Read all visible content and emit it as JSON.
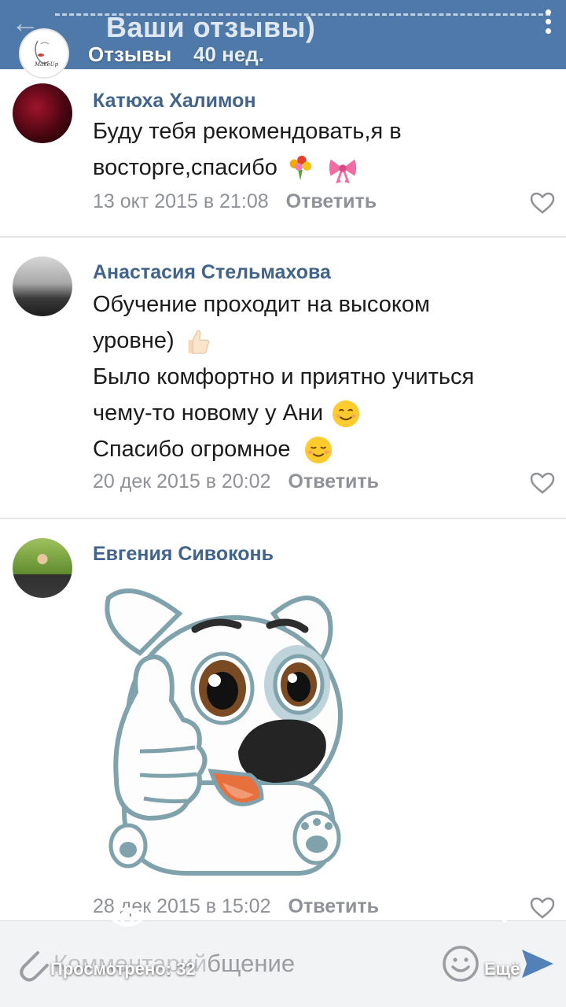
{
  "header": {
    "topic": "Ваши отзывы)",
    "story_author": "Отзывы",
    "story_time": "40 нед."
  },
  "comments": [
    {
      "name": "Катюха Халимон",
      "lines": [
        "Буду тебя рекомендовать,я в",
        "восторге,спасибо"
      ],
      "date": "13 окт 2015 в 21:08",
      "reply": "Ответить"
    },
    {
      "name": "Анастасия Стельмахова",
      "lines": [
        "Обучение проходит на высоком",
        "уровне)",
        "Было комфортно и приятно учиться",
        "чему-то новому у Ани",
        "Спасибо огромное"
      ],
      "date": "20 дек 2015 в 20:02",
      "reply": "Ответить"
    },
    {
      "name": "Евгения Сивоконь",
      "date": "28 дек 2015 в 15:02",
      "reply": "Ответить"
    }
  ],
  "composer": {
    "placeholder": "Комментарий",
    "visible_fragment": "бщение"
  },
  "story_overlay": {
    "views": "Просмотрено: 32",
    "more": "Ещё"
  },
  "colors": {
    "header_bg": "#4e79a8",
    "name": "#42648b",
    "meta": "#8e9197",
    "accent": "#5181b8"
  },
  "icons": [
    "back-arrow-icon",
    "menu-dots-icon",
    "heart-icon",
    "paperclip-icon",
    "smile-icon",
    "send-icon",
    "eye-icon"
  ]
}
